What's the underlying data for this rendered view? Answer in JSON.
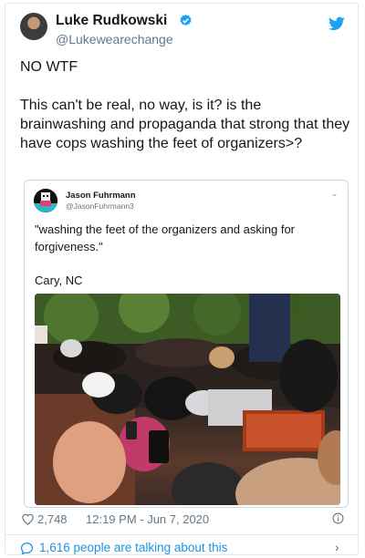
{
  "tweet": {
    "name": "Luke Rudkowski",
    "handle": "@Lukewearechange",
    "text": "NO WTF\n\nThis can't be real, no way, is it? is the brainwashing and propaganda that strong that they have cops washing the feet of organizers>?",
    "likes": "2,748",
    "timestamp": "12:19 PM - Jun 7, 2020",
    "footer_text": "1,616 people are talking about this"
  },
  "quote": {
    "name": "Jason Fuhrmann",
    "handle": "@JasonFuhrmann3",
    "text": "\"washing the feet of the organizers and asking for forgiveness.\"\n\nCary, NC"
  },
  "icons": {
    "verified": "verified-badge-icon",
    "brand": "twitter-bird-icon",
    "like": "heart-icon",
    "info": "info-icon",
    "comment": "comment-bubble-icon",
    "more": "chevron-down-icon",
    "forward": "chevron-right-icon"
  },
  "colors": {
    "accent": "#1da1f2",
    "link": "#1b95e0",
    "muted": "#657786",
    "border": "#e1e8ed"
  }
}
